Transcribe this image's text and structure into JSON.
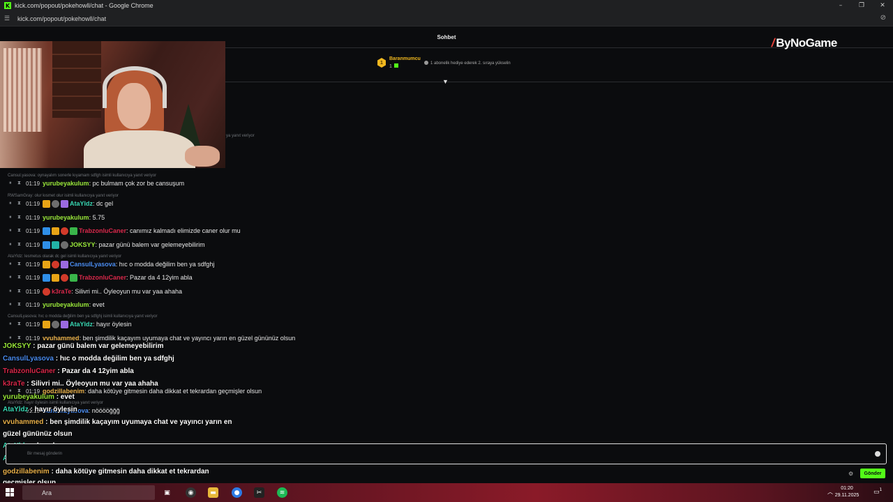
{
  "window": {
    "title": "kick.com/popout/pokehowll/chat - Google Chrome",
    "url": "kick.com/popout/pokehowll/chat",
    "minimize": "–",
    "maximize": "❐",
    "close": "✕"
  },
  "chat_header": {
    "title": "Sohbet"
  },
  "overlay_brand": {
    "name": "ByNoGame"
  },
  "pinned_gifter": {
    "rank": "1",
    "username": "Baranmumcu",
    "count": "1",
    "note": "1 abonelik hediye ederek 2. sıraya yükselin"
  },
  "webcam_reply_note": "ya yanıt veriyor",
  "messages": [
    {
      "reply": "Cansul.yasova: oynayalım sonerle kıyamam sdfgh isimli kullanıcıya yanıt veriyor",
      "time": "01:19",
      "badges": [],
      "user": "yurubeyakulum",
      "user_color": "#9ae83a",
      "text": ": pc bulmam çok zor be cansuşum"
    },
    {
      "reply": "RWSamGray: olur kısmet olur isimli kullanıcıya yanıt veriyor",
      "time": "01:19",
      "badges": [
        "gold",
        "gray",
        "pur"
      ],
      "user": "AtaYldz",
      "user_color": "#37d6b2",
      "text": ": dc gel"
    },
    {
      "reply": "",
      "time": "01:19",
      "badges": [],
      "user": "yurubeyakulum",
      "user_color": "#9ae83a",
      "text": ": 5.75"
    },
    {
      "reply": "",
      "time": "01:19",
      "badges": [
        "blue",
        "gold",
        "red",
        "grn"
      ],
      "user": "TrabzonluCaner",
      "user_color": "#d8284a",
      "text": ": canımız kalmadı elimizde caner olur mu"
    },
    {
      "reply": "",
      "time": "01:19",
      "badges": [
        "blue",
        "teal",
        "gray"
      ],
      "user": "JOKSYY",
      "user_color": "#9ae83a",
      "text": ": pazar günü balem var gelemeyebilirim"
    },
    {
      "reply": "AtaYldz: lesmetus olarak dc gel isimli kullanıcıya yanıt veriyor",
      "time": "01:19",
      "badges": [
        "gold",
        "red",
        "pur"
      ],
      "user": "CansulLyasova",
      "user_color": "#4a8cf0",
      "text": ": hıc o modda değilim ben ya sdfghj"
    },
    {
      "reply": "",
      "time": "01:19",
      "badges": [
        "blue",
        "gold",
        "red",
        "grn"
      ],
      "user": "TrabzonluCaner",
      "user_color": "#d8284a",
      "text": ": Pazar da 4 12yim abla"
    },
    {
      "reply": "",
      "time": "01:19",
      "badges": [
        "red"
      ],
      "user": "k3raTe",
      "user_color": "#d8284a",
      "text": ": Silivri mi.. Öyleoyun mu var yaa ahaha"
    },
    {
      "reply": "",
      "time": "01:19",
      "badges": [],
      "user": "yurubeyakulum",
      "user_color": "#9ae83a",
      "text": ": evet"
    },
    {
      "reply": "CansulLyasova: hıc o modda değilim ben ya sdfghj isimli kullanıcıya yanıt veriyor",
      "time": "01:19",
      "badges": [
        "gold",
        "gray",
        "pur"
      ],
      "user": "AtaYldz",
      "user_color": "#37d6b2",
      "text": ": hayır öylesin"
    },
    {
      "reply": "",
      "time": "01:19",
      "badges": [],
      "user": "vvuhammed",
      "user_color": "#e8b04a",
      "text": ": ben şimdilik kaçayım uyumaya chat ve yayıncı yarın en güzel gününüz olsun"
    },
    {
      "reply": "",
      "time": "01:19",
      "badges": [],
      "user": "godzillabenim",
      "user_color": "#e8b04a",
      "text": ": daha kötüye gitmesin daha dikkat et tekrardan geçmişler olsun"
    },
    {
      "reply": "AtaYldz: hayır öylesin isimli kullanıcıya yanıt veriyor",
      "time": "01:19",
      "badges": [],
      "user": "CansulLyasova",
      "user_color": "#4a8cf0",
      "text": ": nööööğğğ"
    }
  ],
  "overlay_lines": [
    {
      "user": "JOKSYY",
      "user_color": "#9ae83a",
      "text": " : pazar günü balem var gelemeyebilirim"
    },
    {
      "user": "CansulLyasova",
      "user_color": "#4a8cf0",
      "text": " : hıc o modda değilim ben ya sdfghj"
    },
    {
      "user": "TrabzonluCaner",
      "user_color": "#d8284a",
      "text": " : Pazar da 4 12yim abla"
    },
    {
      "user": "k3raTe",
      "user_color": "#d8284a",
      "text": " : Silivri mi.. Öyleoyun mu var yaa ahaha"
    },
    {
      "user": "yurubeyakulum",
      "user_color": "#9ae83a",
      "text": " : evet"
    },
    {
      "user": "AtaYldz",
      "user_color": "#37d6b2",
      "text": " : hayır öylesin"
    },
    {
      "user": "vvuhammed",
      "user_color": "#e8b04a",
      "text": " : ben şimdilik kaçayım uyumaya chat ve yayıncı yarın en"
    },
    {
      "user": "",
      "user_color": "#ffffff",
      "text": "güzel gününüz olsun"
    },
    {
      "user": "AtaYldz",
      "user_color": "#37d6b2",
      "text": " : dc gel"
    },
    {
      "user": "AtaYldz",
      "user_color": "#37d6b2",
      "text": " : şevval nerde"
    },
    {
      "user": "godzillabenim",
      "user_color": "#e8b04a",
      "text": " : daha kötüye gitmesin daha dikkat et tekrardan"
    },
    {
      "user": "",
      "user_color": "#ffffff",
      "text": "geçmişler olsun"
    },
    {
      "user": "CansulLyasova",
      "user_color": "#4a8cf0",
      "text": " : nööööğğğ"
    }
  ],
  "composer": {
    "placeholder": "Bir mesaj gönderin",
    "send_label": "Gönder"
  },
  "taskbar": {
    "search_label": "Ara",
    "time": "01:20",
    "date": "29.11.2025",
    "notification_count": "1"
  },
  "colors": {
    "kick_green": "#53fc18",
    "accent_gold": "#f1b81f"
  }
}
